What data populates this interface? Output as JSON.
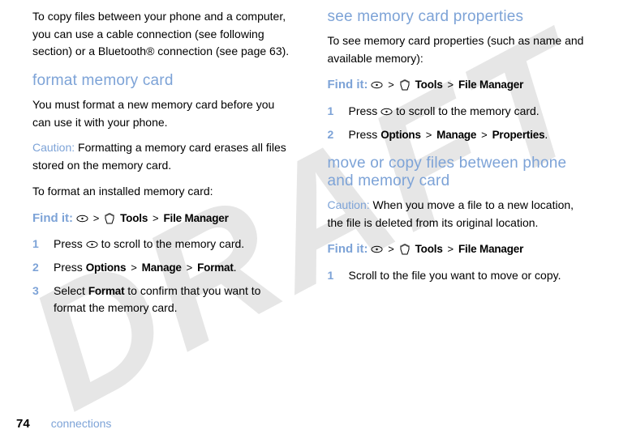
{
  "watermark": "DRAFT",
  "left": {
    "p1_a": "To ",
    "p1_b": "copy files",
    "p1_c": " between your phone and a computer, you can use a cable connection (see following section) or a Bluetooth® connection (see page 63).",
    "h1": "format memory card",
    "p2": "You must format a new memory card before you can use it with your phone.",
    "caution_label": "Caution:",
    "caution_a": " Formatting a memory card ",
    "caution_b": "erases",
    "caution_c": " all files stored on the memory card.",
    "p3": "To format an installed memory card:",
    "findit": "Find it:",
    "tools": "Tools",
    "filemgr": "File Manager",
    "step1": "Press ",
    "step1b": " to scroll to the memory card.",
    "step2a": "Press ",
    "options": "Options",
    "manage": "Manage",
    "format": "Format",
    "step3a": "Select ",
    "step3b": "Format",
    "step3c": " to confirm that you want to format the memory card."
  },
  "right": {
    "h1": "see memory card properties",
    "p1": "To see memory card properties (such as name and available memory):",
    "findit": "Find it:",
    "tools": "Tools",
    "filemgr": "File Manager",
    "step1": "Press ",
    "step1b": " to scroll to the memory card.",
    "step2a": "Press ",
    "options": "Options",
    "manage": "Manage",
    "properties": "Properties",
    "h2": "move or copy files between phone and memory card",
    "caution_label": "Caution:",
    "c2a": " When you ",
    "c2b": "move",
    "c2c": " a file to a new location, the file is ",
    "c2d": "deleted",
    "c2e": " from its original location.",
    "step3": "Scroll to the file you want to move or copy."
  },
  "footer": {
    "page": "74",
    "section": "connections"
  },
  "numbers": {
    "n1": "1",
    "n2": "2",
    "n3": "3"
  },
  "punct": {
    "gt": ">",
    "dot": "."
  }
}
